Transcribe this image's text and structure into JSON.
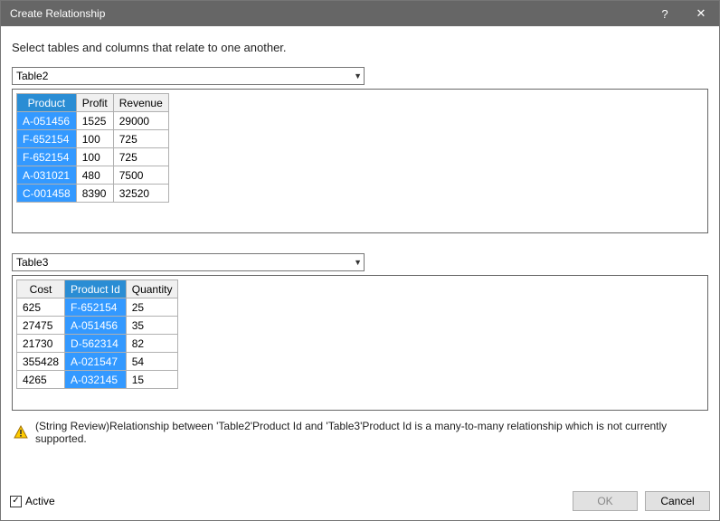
{
  "titlebar": {
    "title": "Create Relationship"
  },
  "instruction": "Select tables and columns that relate to one another.",
  "combo1": {
    "value": "Table2"
  },
  "combo2": {
    "value": "Table3"
  },
  "table1": {
    "headers": [
      "Product",
      "Profit",
      "Revenue"
    ],
    "selectedCol": 0,
    "rows": [
      [
        "A-051456",
        "1525",
        "29000"
      ],
      [
        "F-652154",
        "100",
        "725"
      ],
      [
        "F-652154",
        "100",
        "725"
      ],
      [
        "A-031021",
        "480",
        "7500"
      ],
      [
        "C-001458",
        "8390",
        "32520"
      ]
    ]
  },
  "table2": {
    "headers": [
      "Cost",
      "Product Id",
      "Quantity"
    ],
    "selectedCol": 1,
    "rows": [
      [
        "625",
        "F-652154",
        "25"
      ],
      [
        "27475",
        "A-051456",
        "35"
      ],
      [
        "21730",
        "D-562314",
        "82"
      ],
      [
        "355428",
        "A-021547",
        "54"
      ],
      [
        "4265",
        "A-032145",
        "15"
      ]
    ]
  },
  "warning": "(String Review)Relationship between 'Table2'Product Id and 'Table3'Product Id is a many-to-many relationship which is not currently supported.",
  "footer": {
    "activeLabel": "Active",
    "activeChecked": true,
    "okLabel": "OK",
    "cancelLabel": "Cancel"
  }
}
